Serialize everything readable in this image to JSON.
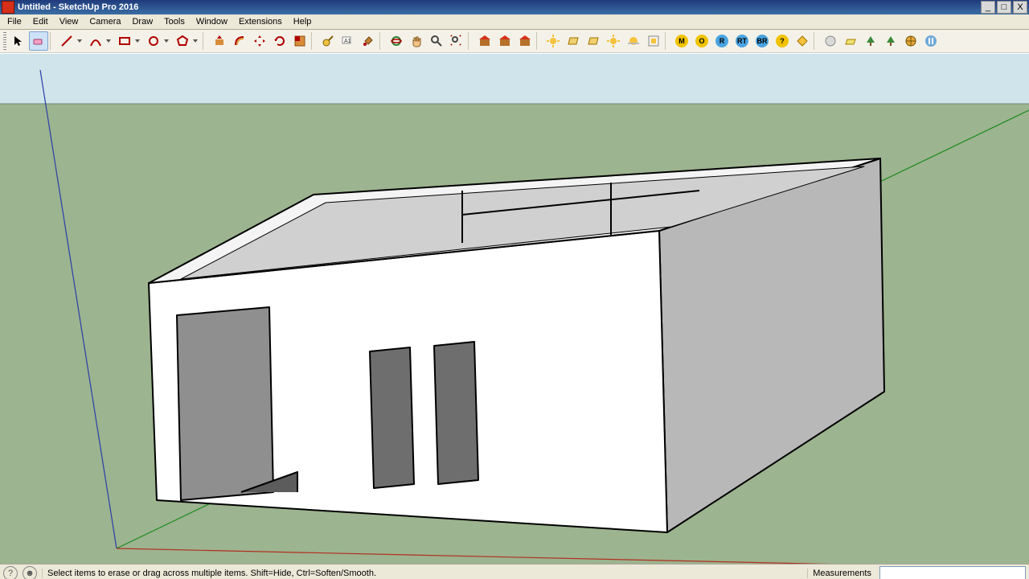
{
  "window": {
    "title": "Untitled - SketchUp Pro 2016",
    "controls": {
      "min": "_",
      "max": "□",
      "close": "X"
    }
  },
  "menu": [
    "File",
    "Edit",
    "View",
    "Camera",
    "Draw",
    "Tools",
    "Window",
    "Extensions",
    "Help"
  ],
  "toolbar": [
    {
      "id": "select",
      "name": "select-tool"
    },
    {
      "id": "eraser",
      "name": "eraser-tool",
      "selected": true
    },
    {
      "sep": true
    },
    {
      "id": "line",
      "name": "line-tool",
      "drop": true
    },
    {
      "id": "arc",
      "name": "arc-tool",
      "drop": true
    },
    {
      "id": "rect",
      "name": "rectangle-tool",
      "drop": true
    },
    {
      "id": "circle",
      "name": "circle-tool",
      "drop": true
    },
    {
      "id": "poly",
      "name": "polygon-tool",
      "drop": true
    },
    {
      "sep": true
    },
    {
      "id": "pushpull",
      "name": "pushpull-tool"
    },
    {
      "id": "offset",
      "name": "offset-tool"
    },
    {
      "id": "move",
      "name": "move-tool"
    },
    {
      "id": "rotate",
      "name": "rotate-tool"
    },
    {
      "id": "scale",
      "name": "scale-tool"
    },
    {
      "sep": true
    },
    {
      "id": "tape",
      "name": "tape-measure-tool"
    },
    {
      "id": "text",
      "name": "text-tool"
    },
    {
      "id": "paint",
      "name": "paint-bucket-tool"
    },
    {
      "sep": true
    },
    {
      "id": "orbit",
      "name": "orbit-tool"
    },
    {
      "id": "pan",
      "name": "pan-tool"
    },
    {
      "id": "zoom",
      "name": "zoom-tool"
    },
    {
      "id": "zoomext",
      "name": "zoom-extents-tool"
    },
    {
      "sep": true
    },
    {
      "id": "whs1",
      "name": "warehouse-icon"
    },
    {
      "id": "whs2",
      "name": "warehouse-share-icon"
    },
    {
      "id": "ext",
      "name": "extension-warehouse-icon"
    },
    {
      "sep": true
    },
    {
      "id": "sun",
      "name": "sun-icon"
    },
    {
      "id": "plane1",
      "name": "section-plane-icon"
    },
    {
      "id": "plane2",
      "name": "section-display-icon"
    },
    {
      "id": "sun2",
      "name": "shadow-icon"
    },
    {
      "id": "fog",
      "name": "fog-icon"
    },
    {
      "id": "xray",
      "name": "xray-icon"
    },
    {
      "sep": true
    },
    {
      "id": "m",
      "name": "vray-m-badge",
      "badge": "M",
      "bg": "#f0c300"
    },
    {
      "id": "o",
      "name": "vray-o-badge",
      "badge": "O",
      "bg": "#f0c300"
    },
    {
      "id": "r",
      "name": "vray-r-badge",
      "badge": "R",
      "bg": "#4aa3e0"
    },
    {
      "id": "rt",
      "name": "vray-rt-badge",
      "badge": "RT",
      "bg": "#4aa3e0"
    },
    {
      "id": "br",
      "name": "vray-br-badge",
      "badge": "BR",
      "bg": "#4aa3e0"
    },
    {
      "id": "q",
      "name": "vray-help-badge",
      "badge": "?",
      "bg": "#f0c300"
    },
    {
      "id": "diamond",
      "name": "vray-diamond-icon"
    },
    {
      "sep": true
    },
    {
      "id": "sphere",
      "name": "vray-sphere-icon"
    },
    {
      "id": "planeY",
      "name": "vray-plane-icon"
    },
    {
      "id": "tree1",
      "name": "vray-tree1-icon"
    },
    {
      "id": "tree2",
      "name": "vray-tree2-icon"
    },
    {
      "id": "globe",
      "name": "vray-globe-icon"
    },
    {
      "id": "pause",
      "name": "vray-pause-icon"
    }
  ],
  "status": {
    "hint": "Select items to erase or drag across multiple items. Shift=Hide, Ctrl=Soften/Smooth.",
    "measurements_label": "Measurements"
  }
}
